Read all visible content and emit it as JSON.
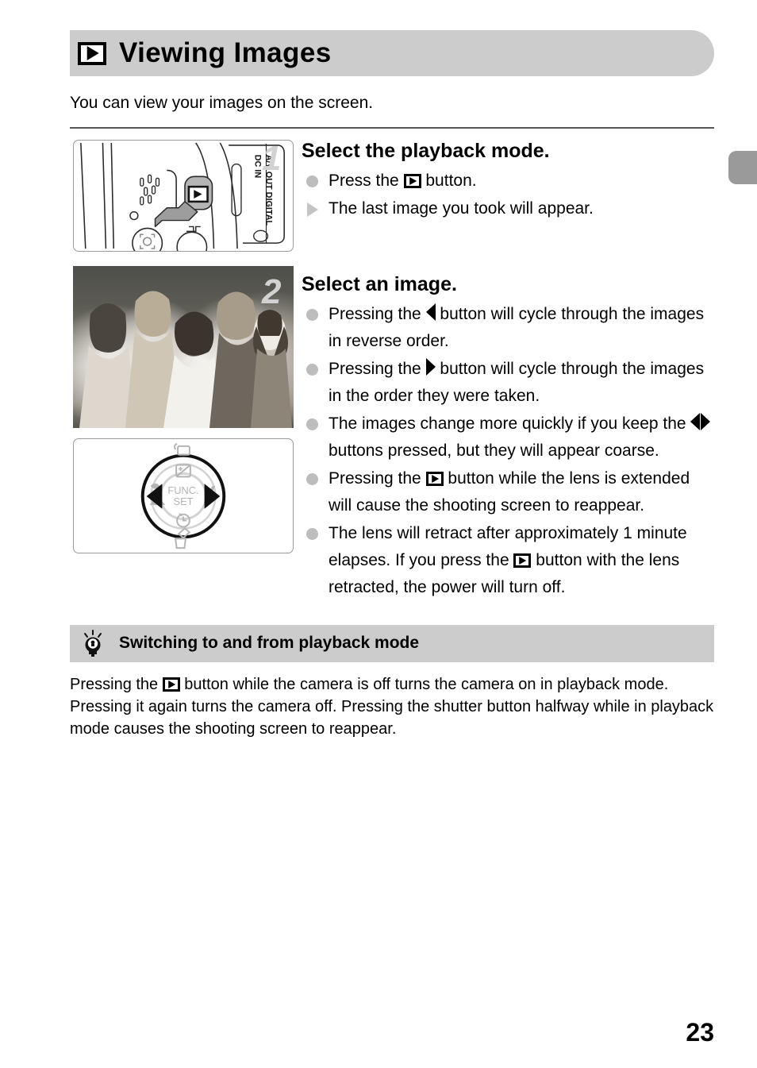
{
  "page": {
    "number": "23",
    "edge_tab_color": "#9a9a9a",
    "heading_bar_color": "#cccccc"
  },
  "heading": {
    "icon": "playback-button-icon",
    "title": "Viewing Images"
  },
  "intro": "You can view your images on the screen.",
  "steps": [
    {
      "number": "1",
      "title": "Select the playback mode.",
      "figure": "camera-back-playback-button-illustration",
      "bullets": [
        {
          "marker": "dot",
          "parts": [
            {
              "type": "text",
              "value": "Press the "
            },
            {
              "type": "icon",
              "value": "playback-button-icon"
            },
            {
              "type": "text",
              "value": " button."
            }
          ]
        },
        {
          "marker": "triangle",
          "parts": [
            {
              "type": "text",
              "value": "The last image you took will appear."
            }
          ]
        }
      ]
    },
    {
      "number": "2",
      "title": "Select an image.",
      "figure": "sample-photo-children-with-dog",
      "figure2": "control-dial-illustration",
      "bullets": [
        {
          "marker": "dot",
          "parts": [
            {
              "type": "text",
              "value": "Pressing the "
            },
            {
              "type": "icon",
              "value": "left-arrow-icon"
            },
            {
              "type": "text",
              "value": " button will cycle through the images in reverse order."
            }
          ]
        },
        {
          "marker": "dot",
          "parts": [
            {
              "type": "text",
              "value": "Pressing the "
            },
            {
              "type": "icon",
              "value": "right-arrow-icon"
            },
            {
              "type": "text",
              "value": " button will cycle through the images in the order they were taken."
            }
          ]
        },
        {
          "marker": "dot",
          "parts": [
            {
              "type": "text",
              "value": "The images change more quickly if you keep the "
            },
            {
              "type": "icon",
              "value": "left-right-arrows-icon"
            },
            {
              "type": "text",
              "value": " buttons pressed, but they will appear coarse."
            }
          ]
        },
        {
          "marker": "dot",
          "parts": [
            {
              "type": "text",
              "value": "Pressing the "
            },
            {
              "type": "icon",
              "value": "playback-button-icon"
            },
            {
              "type": "text",
              "value": " button while the lens is extended will cause the shooting screen to reappear."
            }
          ]
        },
        {
          "marker": "dot",
          "parts": [
            {
              "type": "text",
              "value": "The lens will retract after approximately 1 minute elapses. If you press the "
            },
            {
              "type": "icon",
              "value": "playback-button-icon"
            },
            {
              "type": "text",
              "value": " button with the lens retracted, the power will turn off."
            }
          ]
        }
      ]
    }
  ],
  "tip": {
    "icon": "lightbulb-icon",
    "title": "Switching to and from playback mode",
    "body_parts": [
      {
        "type": "text",
        "value": "Pressing the "
      },
      {
        "type": "icon",
        "value": "playback-button-icon"
      },
      {
        "type": "text",
        "value": " button while the camera is off turns the camera on in playback mode. Pressing it again turns the camera off. Pressing the shutter button halfway while in playback mode causes the shooting screen to reappear."
      }
    ]
  },
  "figures": {
    "camera_labels": {
      "port_label_line1": "DC IN",
      "port_label_line2": "A/V OUT DIGITAL"
    },
    "dial_labels": {
      "center_line1": "FUNC.",
      "center_line2": "SET"
    }
  }
}
